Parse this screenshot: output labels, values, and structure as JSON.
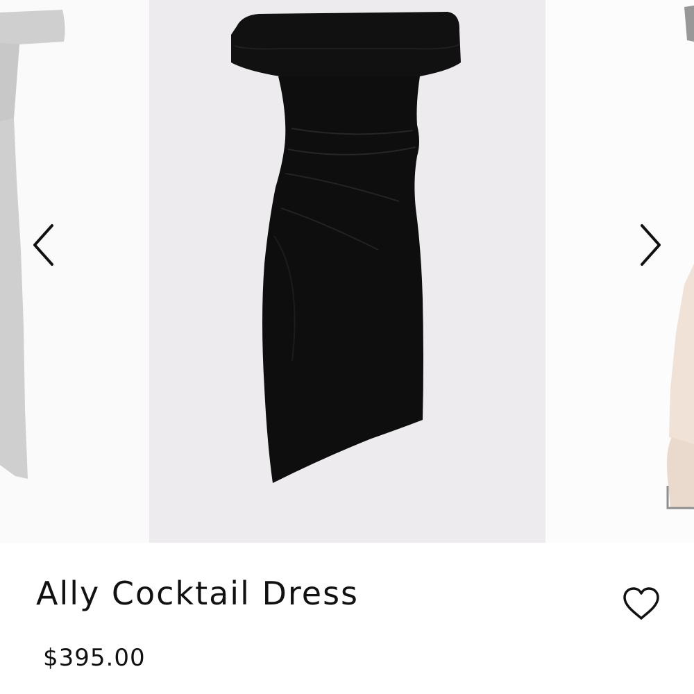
{
  "product": {
    "name": "Ally Cocktail Dress",
    "price": "$395.00"
  },
  "carousel": {
    "prev_label": "Previous image",
    "next_label": "Next image"
  },
  "wishlist": {
    "label": "Add to wishlist"
  },
  "icons": {
    "prev": "chevron-left-icon",
    "next": "chevron-right-icon",
    "wishlist": "heart-icon"
  },
  "colors": {
    "text": "#111111",
    "dress": "#0e0e0e",
    "slide_bg": "#edebee"
  }
}
